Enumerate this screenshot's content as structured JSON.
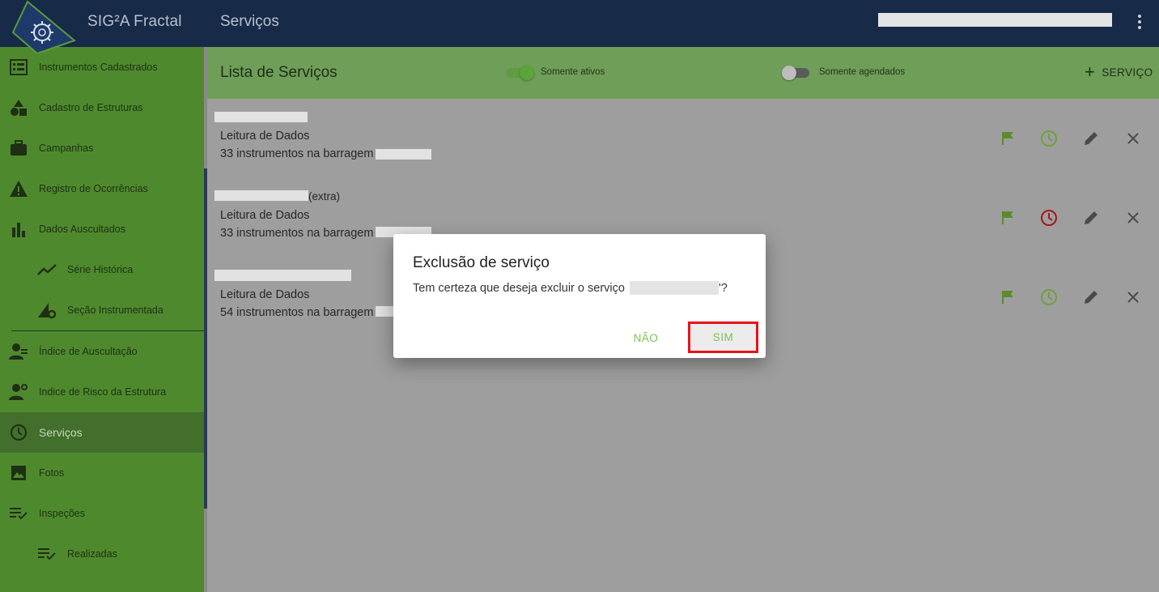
{
  "header": {
    "app_title": "SIG²A Fractal",
    "page_title": "Serviços",
    "logo_icon": "gear-bulb-logo-icon",
    "menu_icon": "kebab-menu-icon"
  },
  "sidebar": {
    "items": [
      {
        "label": "Instrumentos Cadastrados",
        "icon": "list-icon"
      },
      {
        "label": "Cadastro de Estruturas",
        "icon": "shapes-icon"
      },
      {
        "label": "Campanhas",
        "icon": "briefcase-icon"
      },
      {
        "label": "Registro de Ocorrências",
        "icon": "warning-icon"
      },
      {
        "label": "Dados Auscultados",
        "icon": "bar-chart-icon"
      },
      {
        "label": "Série Histórica",
        "icon": "trend-icon"
      },
      {
        "label": "Seção Instrumentada",
        "icon": "section-gear-icon"
      },
      {
        "label": "Índice de Auscultação",
        "icon": "engineer-icon"
      },
      {
        "label": "Indice de Risco da Estrutura",
        "icon": "engineer-icon"
      },
      {
        "label": "Serviços",
        "icon": "clock-icon"
      },
      {
        "label": "Fotos",
        "icon": "image-icon"
      },
      {
        "label": "Inspeções",
        "icon": "checklist-icon"
      },
      {
        "label": "Realizadas",
        "icon": "checklist-icon"
      }
    ]
  },
  "list": {
    "title": "Lista de Serviços",
    "toggle_active_label": "Somente ativos",
    "toggle_active_on": true,
    "toggle_scheduled_label": "Somente agendados",
    "toggle_scheduled_on": false,
    "add_label": "SERVIÇO"
  },
  "services": [
    {
      "extra": "",
      "type": "Leitura de Dados",
      "description": "33 instrumentos na barragem",
      "clock_color": "#7cb342"
    },
    {
      "extra": "(extra)",
      "type": "Leitura de Dados",
      "description": "33 instrumentos na barragem",
      "clock_color": "#a01818"
    },
    {
      "extra": "",
      "type": "Leitura de Dados",
      "description": "54 instrumentos na barragem",
      "clock_color": "#7cb342"
    }
  ],
  "dialog": {
    "title": "Exclusão de serviço",
    "message": "Tem certeza que deseja excluir o serviço",
    "message_suffix": "'?",
    "cancel_label": "NÃO",
    "confirm_label": "SIM"
  },
  "colors": {
    "topbar": "#172a47",
    "sidebar": "#4e8a2d",
    "accent_green": "#7cc152",
    "highlight_red": "#e8141a"
  }
}
